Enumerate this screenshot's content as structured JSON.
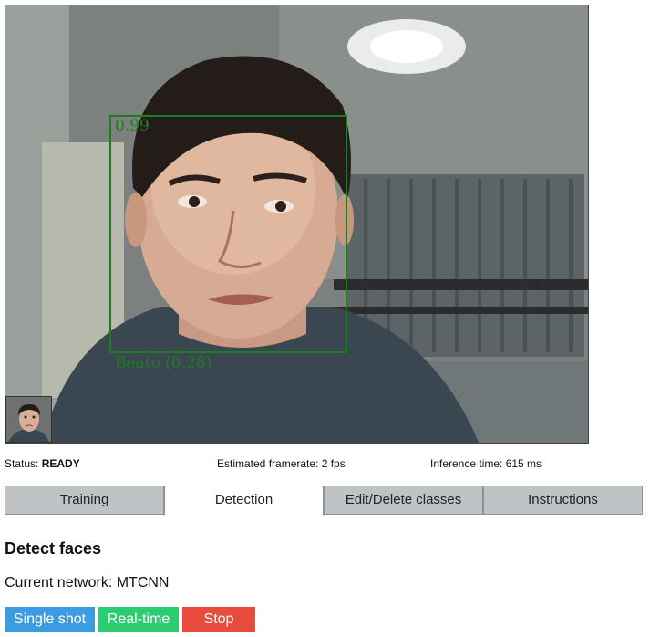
{
  "video": {
    "detection": {
      "score": "0.99",
      "label": "Beato (0.28)",
      "color": "#1f7d1f"
    }
  },
  "status": {
    "label": "Status:",
    "value": "READY",
    "framerate": "Estimated framerate: 2 fps",
    "inference": "Inference time: 615 ms"
  },
  "tabs": [
    {
      "label": "Training"
    },
    {
      "label": "Detection"
    },
    {
      "label": "Edit/Delete classes"
    },
    {
      "label": "Instructions"
    }
  ],
  "active_tab": "Detection",
  "main": {
    "heading": "Detect faces",
    "network": "Current network: MTCNN"
  },
  "buttons": {
    "single_shot": "Single shot",
    "real_time": "Real-time",
    "stop": "Stop"
  },
  "colors": {
    "single_shot": "#3d9be0",
    "real_time": "#2ecc71",
    "stop": "#e74c3c"
  }
}
